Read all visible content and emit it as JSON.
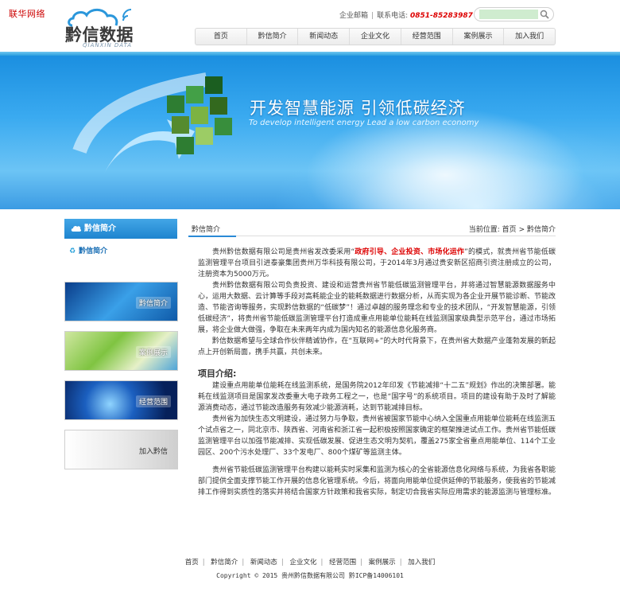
{
  "corner_text": "联华网络",
  "logo": {
    "name": "黔信数据",
    "sub": "QIANXIN DATA"
  },
  "header": {
    "dept_label": "企业邮箱",
    "phone_label": "联系电话:",
    "phone": "0851-85283987",
    "search_placeholder": ""
  },
  "nav": [
    "首页",
    "黔信简介",
    "新闻动态",
    "企业文化",
    "经营范围",
    "案例展示",
    "加入我们"
  ],
  "banner": {
    "title": "开发智慧能源 引领低碳经济",
    "subtitle": "To develop intelligent energy Lead a low carbon economy"
  },
  "sidebar": {
    "heading": "黔信简介",
    "item": "黔信简介",
    "buttons": [
      "黔信简介",
      "案例展示",
      "经营范围",
      "加入黔信"
    ]
  },
  "crumb": {
    "title": "黔信简介",
    "location_label": "当前位置:",
    "home": "首页",
    "current": "黔信简介"
  },
  "content": {
    "p1_a": "贵州黔信数据有限公司是贵州省发改委采用“",
    "p1_red": "政府引导、企业投资、市场化运作",
    "p1_b": "”的模式，就贵州省节能低碳监测管理平台项目引进泰豪集团贵州万华科技有限公司，于2014年3月通过贵安新区招商引资注册成立的公司，注册资本为5000万元。",
    "p2": "贵州黔信数据有限公司负责投资、建设和运营贵州省节能低碳监测管理平台，并将通过智慧能源数据服务中心，运用大数据、云计算等手段对高耗能企业的能耗数据进行数据分析，从而实现为各企业开展节能诊断、节能改造、节能咨询等服务，实现黔信数据的“低碳梦”！通过卓越的服务理念和专业的技术团队，“开发智慧能源，引领低碳经济”，将贵州省节能低碳监测管理平台打造成重点用能单位能耗在线监测国家级典型示范平台，通过市场拓展，将企业做大做强，争取在未来两年内成为国内知名的能源信息化服务商。",
    "p3": "黔信数据希望与全球合作伙伴精诚协作，在“互联网+”的大时代背景下，在贵州省大数据产业蓬勃发展的新起点上开创新局面，携手共赢，共创未来。",
    "h3": "项目介绍:",
    "p4": "建设重点用能单位能耗在线监测系统，是国务院2012年印发《节能减排“十二五”规划》作出的决策部署。能耗在线监测项目是国家发改委重大电子政务工程之一，也是“国字号”的系统项目。项目的建设有助于及时了解能源消费动态，通过节能改造服务有效减少能源消耗，达到节能减排目标。",
    "p5": "贵州省为加快生态文明建设，通过努力与争取，贵州省被国家节能中心纳入全国重点用能单位能耗在线监测五个试点省之一，同北京市、陕西省、河南省和浙江省一起积极按照国家确定的框架推进试点工作。贵州省节能低碳监测管理平台以加强节能减排、实现低碳发展、促进生态文明为契机，覆盖275家全省重点用能单位、114个工业园区、200个污水处理厂、33个发电厂、800个煤矿等监测主体。",
    "p6": "贵州省节能低碳监测管理平台构建以能耗实时采集和监测为核心的全省能源信息化网络与系统，为我省各职能部门提供全面支撑节能工作开展的信息化管理系统。今后，将面向用能单位提供延伸的节能服务，使我省的节能减排工作得到实质性的落实并将结合国家方针政策和我省实际，制定切合我省实际应用需求的能源监测与管理标准。"
  },
  "footer": {
    "links": [
      "首页",
      "黔信简介",
      "新闻动态",
      "企业文化",
      "经营范围",
      "案例展示",
      "加入我们"
    ],
    "copyright": "Copyright © 2015 贵州黔信数据有限公司 黔ICP备14006101"
  }
}
